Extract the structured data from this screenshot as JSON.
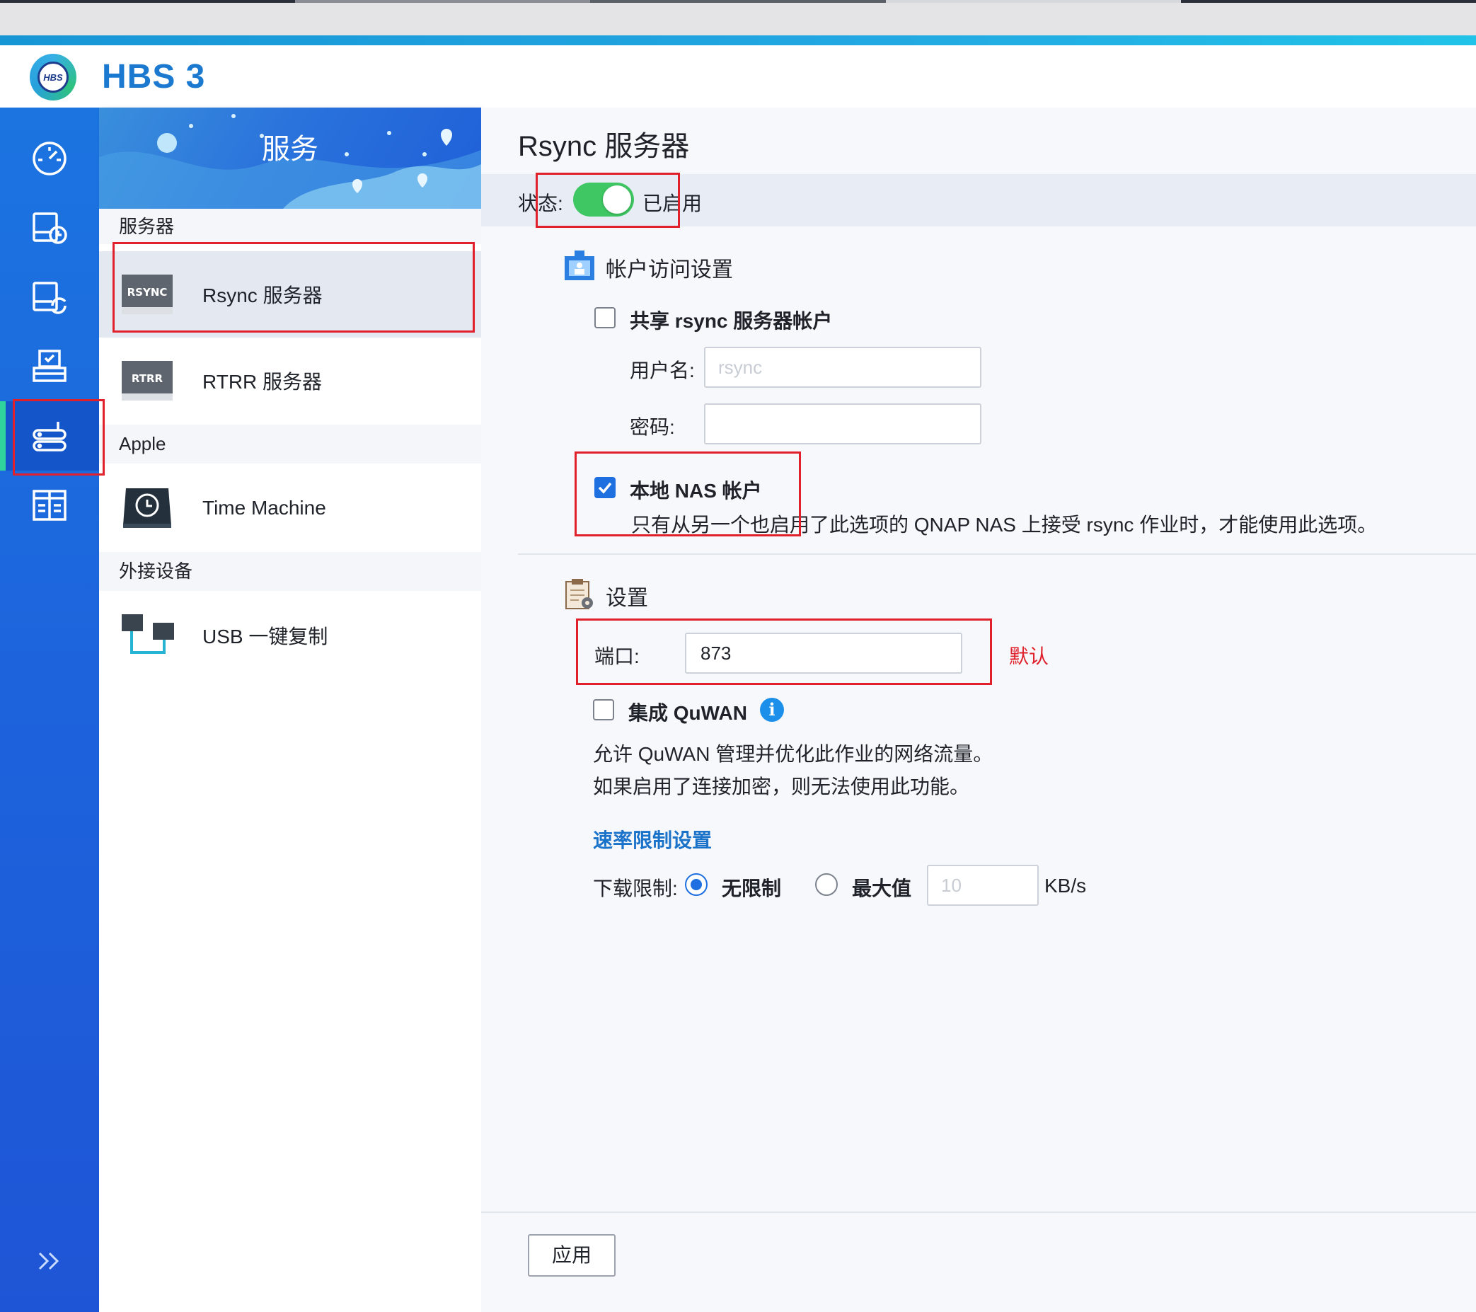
{
  "app": {
    "title": "HBS 3",
    "logo_text": "HBS"
  },
  "rail": {
    "items": [
      {
        "icon": "dashboard-icon"
      },
      {
        "icon": "backup-icon"
      },
      {
        "icon": "sync-icon"
      },
      {
        "icon": "restore-icon"
      },
      {
        "icon": "services-icon",
        "active": true
      },
      {
        "icon": "storage-icon"
      }
    ],
    "expand_icon": "chevron-double-right-icon"
  },
  "services_panel": {
    "banner_title": "服务",
    "sections": [
      {
        "label": "服务器",
        "items": [
          {
            "label": "Rsync 服务器",
            "icon_text": "RSYNC",
            "selected": true
          },
          {
            "label": "RTRR 服务器",
            "icon_text": "RTRR"
          }
        ]
      },
      {
        "label": "Apple",
        "items": [
          {
            "label": "Time Machine"
          }
        ]
      },
      {
        "label": "外接设备",
        "items": [
          {
            "label": "USB 一键复制"
          }
        ]
      }
    ]
  },
  "main": {
    "title": "Rsync 服务器",
    "status_label": "状态:",
    "status_value": "已启用",
    "account_section": {
      "title": "帐户访问设置",
      "share_rsync_label": "共享 rsync 服务器帐户",
      "username_label": "用户名:",
      "username_placeholder": "rsync",
      "password_label": "密码:",
      "password_value": "",
      "local_nas_label": "本地 NAS 帐户",
      "local_nas_desc": "只有从另一个也启用了此选项的 QNAP NAS 上接受 rsync 作业时，才能使用此选项。"
    },
    "settings_section": {
      "title": "设置",
      "port_label": "端口:",
      "port_value": "873",
      "quwan_label": "集成 QuWAN",
      "quwan_desc_1": "允许 QuWAN 管理并优化此作业的网络流量。",
      "quwan_desc_2": "如果启用了连接加密，则无法使用此功能。",
      "rate_limit_link": "速率限制设置",
      "download_limit_label": "下载限制:",
      "unlimited_label": "无限制",
      "max_label": "最大值",
      "max_placeholder": "10",
      "unit": "KB/s"
    },
    "apply_label": "应用"
  },
  "annotations": {
    "default_note": "默认"
  },
  "colors": {
    "accent": "#1b7ad0",
    "rail": "#1d63dc",
    "toggle_on": "#3fc763",
    "annotation": "#e0202a",
    "checkbox_checked": "#1e6fe0"
  }
}
